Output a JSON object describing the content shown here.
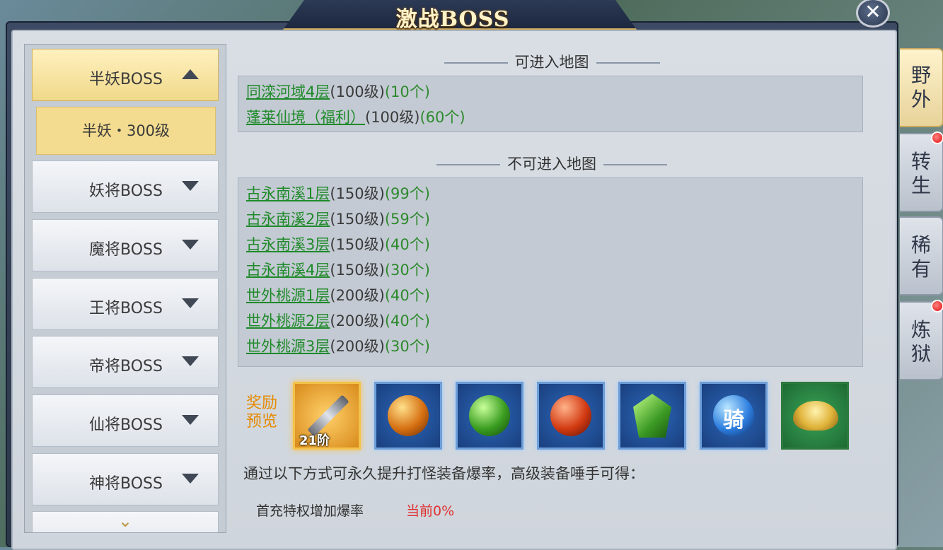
{
  "window": {
    "title": "激战BOSS",
    "close_glyph": "✕"
  },
  "categories": [
    {
      "label": "半妖BOSS",
      "state": "expanded"
    },
    {
      "label": "妖将BOSS",
      "state": "collapsed"
    },
    {
      "label": "魔将BOSS",
      "state": "collapsed"
    },
    {
      "label": "王将BOSS",
      "state": "collapsed"
    },
    {
      "label": "帝将BOSS",
      "state": "collapsed"
    },
    {
      "label": "仙将BOSS",
      "state": "collapsed"
    },
    {
      "label": "神将BOSS",
      "state": "collapsed"
    }
  ],
  "selected_sub": "半妖・300级",
  "accessible": {
    "header": "可进入地图",
    "maps": [
      {
        "name": "同滦河域4层",
        "level": "(100级)",
        "count": "(10个)"
      },
      {
        "name": "蓬莱仙境（福利）",
        "level": "(100级)",
        "count": "(60个)"
      }
    ]
  },
  "inaccessible": {
    "header": "不可进入地图",
    "maps": [
      {
        "name": "古永南溪1层",
        "level": "(150级)",
        "count": "(99个)"
      },
      {
        "name": "古永南溪2层",
        "level": "(150级)",
        "count": "(59个)"
      },
      {
        "name": "古永南溪3层",
        "level": "(150级)",
        "count": "(40个)"
      },
      {
        "name": "古永南溪4层",
        "level": "(150级)",
        "count": "(30个)"
      },
      {
        "name": "世外桃源1层",
        "level": "(200级)",
        "count": "(40个)"
      },
      {
        "name": "世外桃源2层",
        "level": "(200级)",
        "count": "(40个)"
      },
      {
        "name": "世外桃源3层",
        "level": "(200级)",
        "count": "(30个)"
      }
    ]
  },
  "reward": {
    "label_line1": "奖励",
    "label_line2": "预览",
    "items": [
      {
        "icon": "weapon-icon",
        "tier": "21阶"
      },
      {
        "icon": "orange-orb-icon"
      },
      {
        "icon": "green-orb-icon"
      },
      {
        "icon": "red-orb-icon"
      },
      {
        "icon": "green-gem-icon"
      },
      {
        "icon": "mount-orb-icon",
        "glyph": "骑"
      },
      {
        "icon": "gold-ingot-icon"
      }
    ]
  },
  "info": {
    "text": "通过以下方式可永久提升打怪装备爆率，高级装备唾手可得：",
    "first_charge": "首充特权增加爆率",
    "current": "当前0%"
  },
  "side_tabs": [
    {
      "l1": "野",
      "l2": "外",
      "active": true,
      "dot": false
    },
    {
      "l1": "转",
      "l2": "生",
      "active": false,
      "dot": true
    },
    {
      "l1": "稀",
      "l2": "有",
      "active": false,
      "dot": false
    },
    {
      "l1": "炼",
      "l2": "狱",
      "active": false,
      "dot": true
    }
  ],
  "colors": {
    "link_green": "#1f8a2a",
    "reward_orange": "#e68a00",
    "current_red": "#e03030"
  }
}
